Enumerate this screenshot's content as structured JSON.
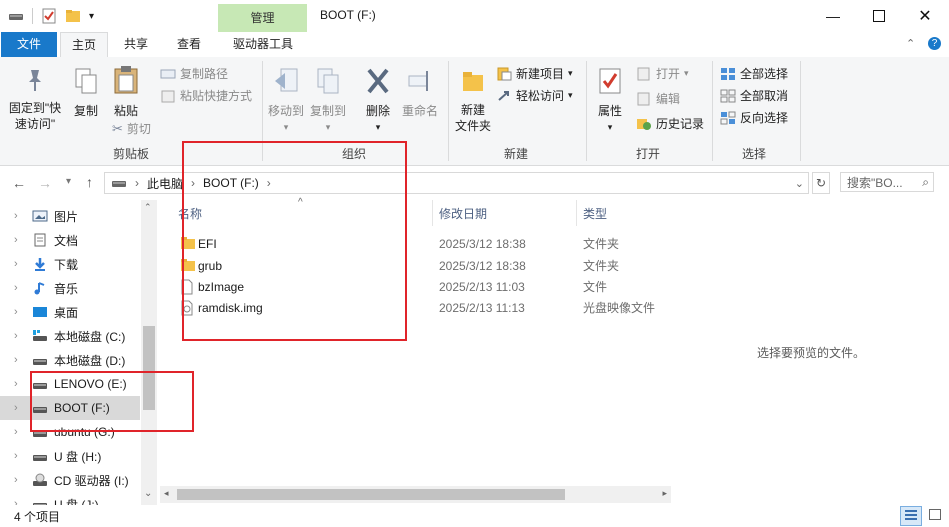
{
  "window": {
    "title": "BOOT (F:)",
    "context_tab": "管理"
  },
  "tabs": {
    "file": "文件",
    "home": "主页",
    "share": "共享",
    "view": "查看",
    "drive_tools": "驱动器工具"
  },
  "ribbon": {
    "clipboard": {
      "pin": "固定到\"快速访问\"",
      "copy": "复制",
      "paste": "粘贴",
      "copy_path": "复制路径",
      "paste_shortcut": "粘贴快捷方式",
      "cut": "剪切",
      "label": "剪贴板"
    },
    "organize": {
      "move_to": "移动到",
      "copy_to": "复制到",
      "delete": "删除",
      "rename": "重命名",
      "label": "组织"
    },
    "new": {
      "new_folder": "新建\n文件夹",
      "new_item": "新建项目",
      "easy_access": "轻松访问",
      "label": "新建"
    },
    "open": {
      "properties": "属性",
      "open": "打开",
      "edit": "编辑",
      "history": "历史记录",
      "label": "打开"
    },
    "select": {
      "select_all": "全部选择",
      "select_none": "全部取消",
      "invert": "反向选择",
      "label": "选择"
    }
  },
  "address": {
    "crumb1": "此电脑",
    "crumb2": "BOOT (F:)",
    "search_placeholder": "搜索\"BO..."
  },
  "nav": {
    "items": [
      {
        "label": "图片",
        "icon": "pictures-icon"
      },
      {
        "label": "文档",
        "icon": "documents-icon"
      },
      {
        "label": "下载",
        "icon": "download-icon"
      },
      {
        "label": "音乐",
        "icon": "music-icon"
      },
      {
        "label": "桌面",
        "icon": "desktop-icon"
      },
      {
        "label": "本地磁盘 (C:)",
        "icon": "drive-c-icon"
      },
      {
        "label": "本地磁盘 (D:)",
        "icon": "drive-icon"
      },
      {
        "label": "LENOVO (E:)",
        "icon": "drive-icon"
      },
      {
        "label": "BOOT (F:)",
        "icon": "drive-icon"
      },
      {
        "label": "ubuntu (G:)",
        "icon": "drive-icon"
      },
      {
        "label": "U 盘 (H:)",
        "icon": "drive-icon"
      },
      {
        "label": "CD 驱动器 (I:)",
        "icon": "cd-drive-icon"
      },
      {
        "label": "U 盘 (J:)",
        "icon": "drive-icon"
      }
    ]
  },
  "columns": {
    "name": "名称",
    "modified": "修改日期",
    "type": "类型"
  },
  "files": [
    {
      "name": "EFI",
      "date": "2025/3/12 18:38",
      "type": "文件夹",
      "icon": "folder-icon"
    },
    {
      "name": "grub",
      "date": "2025/3/12 18:38",
      "type": "文件夹",
      "icon": "folder-icon"
    },
    {
      "name": "bzImage",
      "date": "2025/2/13 11:03",
      "type": "文件",
      "icon": "file-icon"
    },
    {
      "name": "ramdisk.img",
      "date": "2025/2/13 11:13",
      "type": "光盘映像文件",
      "icon": "disc-image-icon"
    }
  ],
  "preview": {
    "empty_text": "选择要预览的文件。"
  },
  "status": {
    "item_count": "4 个项目"
  },
  "colors": {
    "accent": "#1979ca",
    "context_tab": "#c7e8b5",
    "annotation": "#e0242a",
    "folder": "#f4c24a"
  }
}
